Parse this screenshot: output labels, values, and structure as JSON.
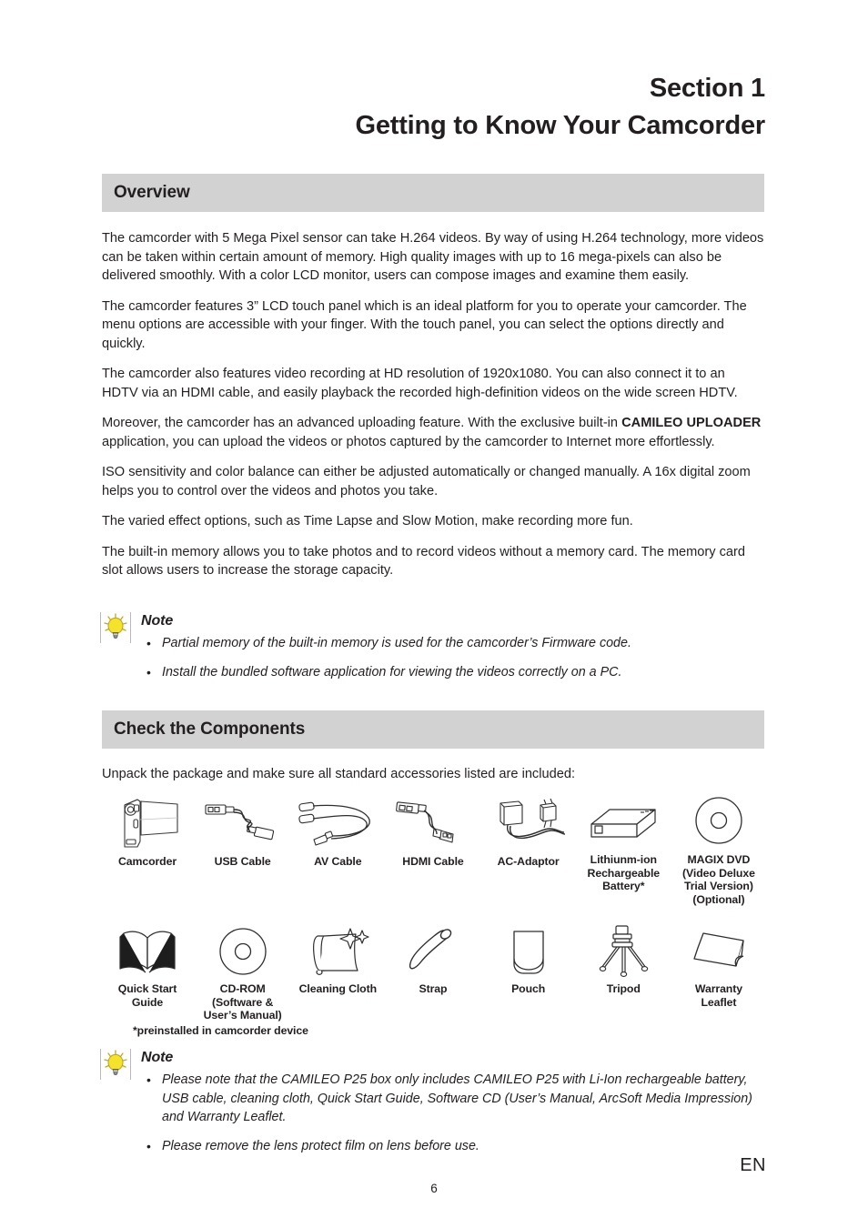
{
  "document": {
    "section_label": "Section 1",
    "section_title": "Getting to Know Your Camcorder",
    "footer_language": "EN",
    "footer_page_number": "6",
    "band_color": "#d2d2d2"
  },
  "overview": {
    "heading": "Overview",
    "paragraphs": [
      {
        "runs": [
          {
            "text": "The camcorder with 5 Mega Pixel sensor can take H.264 videos. By way of using H.264 technology, more videos can be taken within certain amount of memory. High quality images with up to 16 mega-pixels can also be delivered smoothly. With a color LCD monitor, users can compose images and examine them easily.",
            "bold": false
          }
        ]
      },
      {
        "runs": [
          {
            "text": "The camcorder features 3” LCD touch panel which is an ideal platform for you to operate your camcorder. The menu options are accessible with your finger. With the touch panel, you can select the options directly and quickly.",
            "bold": false
          }
        ]
      },
      {
        "runs": [
          {
            "text": "The camcorder also features video recording at HD resolution of 1920x1080. You can also connect it to an HDTV via an HDMI cable, and easily playback the recorded high-definition videos on the wide screen HDTV.",
            "bold": false
          }
        ]
      },
      {
        "runs": [
          {
            "text": "Moreover, the camcorder has an advanced uploading feature. With the exclusive built-in ",
            "bold": false
          },
          {
            "text": "CAMILEO UPLOADER",
            "bold": true
          },
          {
            "text": " application, you can upload the videos or photos captured by the camcorder to Internet more effortlessly.",
            "bold": false
          }
        ]
      },
      {
        "runs": [
          {
            "text": "ISO sensitivity and color balance can either be adjusted automatically or changed manually. A 16x digital zoom helps you to control over the videos and photos you take.",
            "bold": false
          }
        ]
      },
      {
        "runs": [
          {
            "text": "The varied effect options, such as Time Lapse and Slow Motion, make recording more fun.",
            "bold": false
          }
        ]
      },
      {
        "runs": [
          {
            "text": "The built-in memory allows you to take photos and to record videos without a memory card. The memory card slot allows users to increase the storage capacity.",
            "bold": false
          }
        ]
      }
    ],
    "note": {
      "title": "Note",
      "icon": "lightbulb-icon",
      "bullet_char": "•",
      "items": [
        "Partial memory of the built-in memory is used for the camcorder’s Firmware code.",
        "Install the bundled software application for viewing the videos correctly on a PC."
      ]
    }
  },
  "components": {
    "heading": "Check the Components",
    "intro": "Unpack the package and make sure all standard accessories listed are included:",
    "footnote": "*preinstalled in camcorder device",
    "row1": [
      {
        "label": "Camcorder",
        "icon": "camcorder-icon"
      },
      {
        "label": "USB Cable",
        "icon": "usb-cable-icon"
      },
      {
        "label": "AV Cable",
        "icon": "av-cable-icon"
      },
      {
        "label": "HDMI Cable",
        "icon": "hdmi-cable-icon"
      },
      {
        "label": "AC-Adaptor",
        "icon": "ac-adaptor-icon"
      },
      {
        "label": "Lithiunm-ion\nRechargeable\nBattery*",
        "icon": "battery-icon"
      },
      {
        "label": "MAGIX DVD\n(Video Deluxe\nTrial Version)\n(Optional)",
        "icon": "dvd-disc-icon"
      }
    ],
    "row2": [
      {
        "label": "Quick Start\nGuide",
        "icon": "booklet-icon"
      },
      {
        "label": "CD-ROM\n(Software &\nUser’s Manual)",
        "icon": "cdrom-disc-icon"
      },
      {
        "label": "Cleaning Cloth",
        "icon": "cleaning-cloth-icon"
      },
      {
        "label": "Strap",
        "icon": "strap-icon"
      },
      {
        "label": "Pouch",
        "icon": "pouch-icon"
      },
      {
        "label": "Tripod",
        "icon": "tripod-icon"
      },
      {
        "label": "Warranty\nLeaflet",
        "icon": "warranty-leaflet-icon"
      }
    ],
    "note": {
      "title": "Note",
      "icon": "lightbulb-icon",
      "bullet_char": "•",
      "items": [
        "Please note that the CAMILEO P25 box only includes CAMILEO P25 with Li-Ion rechargeable battery, USB cable, cleaning cloth, Quick Start Guide, Software CD (User’s Manual, ArcSoft Media Impression) and Warranty Leaflet.",
        "Please remove the lens protect film on lens before use."
      ]
    }
  }
}
